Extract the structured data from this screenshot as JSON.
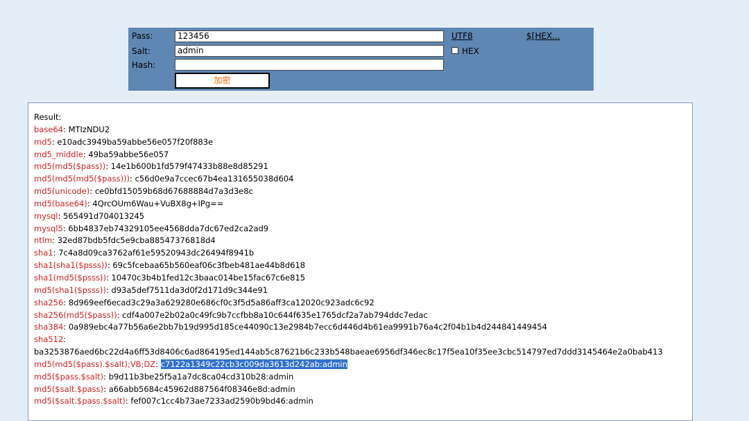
{
  "form": {
    "pass_label": "Pass:",
    "pass_value": "123456",
    "salt_label": "Salt:",
    "salt_value": "admin",
    "hash_label": "Hash:",
    "hash_value": "",
    "utf8_link": "UTF8",
    "hex_link": "$[HEX...",
    "hex_checkbox_label": "HEX",
    "hex_checked": false,
    "encrypt_button": "加密"
  },
  "result": {
    "title": "Result:",
    "rows": [
      {
        "key": "base64",
        "value": "MTIzNDU2"
      },
      {
        "key": "md5",
        "value": "e10adc3949ba59abbe56e057f20f883e"
      },
      {
        "key": "md5_middle",
        "value": "49ba59abbe56e057"
      },
      {
        "key": "md5(md5($pass))",
        "value": "14e1b600b1fd579f47433b88e8d85291"
      },
      {
        "key": "md5(md5(md5($pass)))",
        "value": "c56d0e9a7ccec67b4ea131655038d604"
      },
      {
        "key": "md5(unicode)",
        "value": "ce0bfd15059b68d67688884d7a3d3e8c"
      },
      {
        "key": "md5(base64)",
        "value": "4QrcOUm6Wau+VuBX8g+IPg=="
      },
      {
        "key": "mysql",
        "value": "565491d704013245"
      },
      {
        "key": "mysql5",
        "value": "6bb4837eb74329105ee4568dda7dc67ed2ca2ad9"
      },
      {
        "key": "ntlm",
        "value": "32ed87bdb5fdc5e9cba88547376818d4"
      },
      {
        "key": "sha1",
        "value": "7c4a8d09ca3762af61e59520943dc26494f8941b"
      },
      {
        "key": "sha1(sha1($psss))",
        "value": "69c5fcebaa65b560eaf06c3fbeb481ae44b8d618"
      },
      {
        "key": "sha1(md5($psss))",
        "value": "10470c3b4b1fed12c3baac014be15fac67c6e815"
      },
      {
        "key": "md5(sha1($psss))",
        "value": "d93a5def7511da3d0f2d171d9c344e91"
      },
      {
        "key": "sha256",
        "value": "8d969eef6ecad3c29a3a629280e686cf0c3f5d5a86aff3ca12020c923adc6c92"
      },
      {
        "key": "sha256(md5($pass))",
        "value": "cdf4a007e2b02a0c49fc9b7ccfbb8a10c644f635e1765dcf2a7ab794ddc7edac"
      },
      {
        "key": "sha384",
        "value": "0a989ebc4a77b56a6e2bb7b19d995d185ce44090c13e2984b7ecc6d446d4b61ea9991b76a4c2f04b1b4d244841449454"
      },
      {
        "key": "sha512",
        "value": ""
      },
      {
        "key": "",
        "value": "ba3253876aed6bc22d4a6ff53d8406c6ad864195ed144ab5c87621b6c233b548baeae6956df346ec8c17f5ea10f35ee3cbc514797ed7ddd3145464e2a0bab413"
      },
      {
        "key": "md5(md5($pass).$salt);VB;DZ",
        "value": "c7122a1349c22cb3c009da3613d242ab:admin",
        "selected": true
      },
      {
        "key": "md5($pass.$salt)",
        "value": "b9d11b3be25f5a1a7dc8ca04cd310b28:admin"
      },
      {
        "key": "md5($salt.$pass)",
        "value": "a66abb5684c45962d887564f08346e8d:admin"
      },
      {
        "key": "md5($salt.$pass.$salt)",
        "value": "fef007c1cc4b73ae7233ad2590b9bd46:admin"
      }
    ]
  },
  "colors": {
    "background": "#e4eef6",
    "panel": "#5f87b3",
    "result_key": "#d22020",
    "button_text": "#ff6600",
    "selection": "#3071cc"
  }
}
